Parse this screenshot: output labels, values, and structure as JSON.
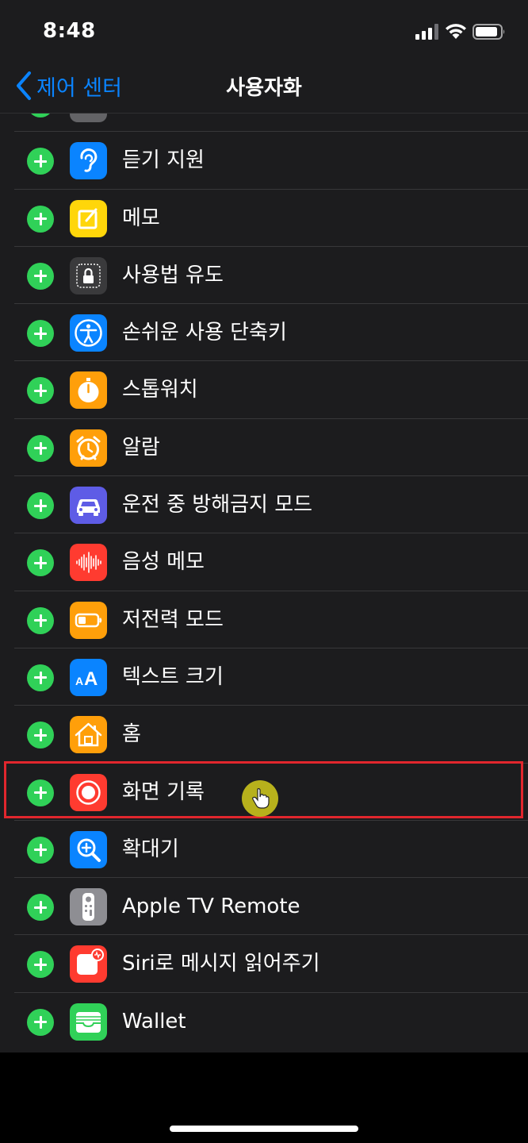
{
  "status_bar": {
    "time": "8:48"
  },
  "nav": {
    "back_label": "제어 센터",
    "title": "사용자화"
  },
  "list": {
    "items": [
      {
        "label": "",
        "icon": "dark-mode-icon",
        "color": "#636366"
      },
      {
        "label": "듣기 지원",
        "icon": "ear-icon",
        "color": "#0a84ff"
      },
      {
        "label": "메모",
        "icon": "notes-icon",
        "color": "#ffd60a"
      },
      {
        "label": "사용법 유도",
        "icon": "lock-icon",
        "color": "#3a3a3c"
      },
      {
        "label": "손쉬운 사용 단축키",
        "icon": "accessibility-icon",
        "color": "#0a84ff"
      },
      {
        "label": "스톱워치",
        "icon": "stopwatch-icon",
        "color": "#ff9f0a"
      },
      {
        "label": "알람",
        "icon": "alarm-icon",
        "color": "#ff9f0a"
      },
      {
        "label": "운전 중 방해금지 모드",
        "icon": "car-icon",
        "color": "#5e5ce6"
      },
      {
        "label": "음성 메모",
        "icon": "waveform-icon",
        "color": "#ff3b30"
      },
      {
        "label": "저전력 모드",
        "icon": "battery-icon",
        "color": "#ff9f0a"
      },
      {
        "label": "텍스트 크기",
        "icon": "text-size-icon",
        "color": "#0a84ff"
      },
      {
        "label": "홈",
        "icon": "home-icon",
        "color": "#ff9f0a"
      },
      {
        "label": "화면 기록",
        "icon": "record-icon",
        "color": "#ff3b30"
      },
      {
        "label": "확대기",
        "icon": "magnifier-icon",
        "color": "#0a84ff"
      },
      {
        "label": "Apple TV Remote",
        "icon": "remote-icon",
        "color": "#8e8e93"
      },
      {
        "label": "Siri로 메시지 읽어주기",
        "icon": "siri-message-icon",
        "color": "#ff3b30"
      },
      {
        "label": "Wallet",
        "icon": "wallet-icon",
        "color": "#30d158"
      }
    ]
  },
  "highlighted_item": "화면 기록"
}
